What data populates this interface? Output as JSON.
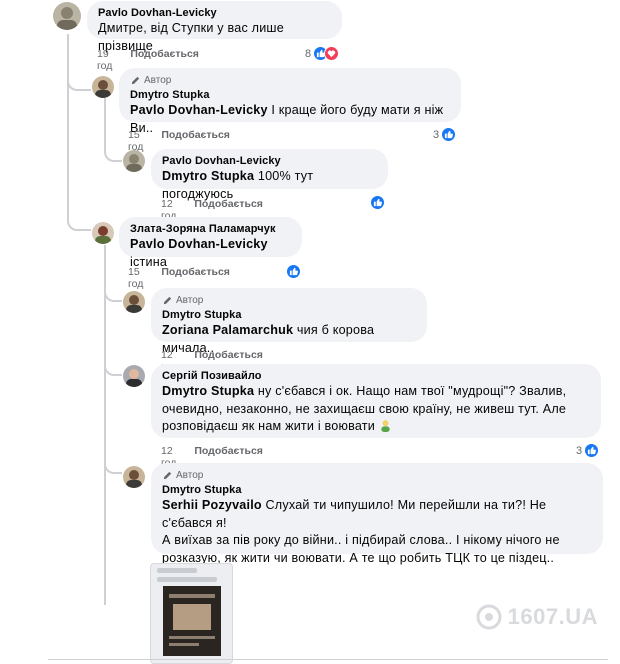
{
  "comments": [
    {
      "id": "c1",
      "author": "Pavlo Dovhan-Levicky",
      "text": "Дмитре, від Ступки у вас лише прізвище",
      "time": "19 год",
      "reply_label": "Подобається",
      "reaction_count": "8",
      "reactions": [
        "like-icon",
        "love-icon"
      ]
    },
    {
      "id": "c2",
      "badge": "Автор",
      "author": "Dmytro Stupka",
      "mention": "Pavlo Dovhan-Levicky",
      "text": "І краще його буду мати я ніж Ви..",
      "time": "15 год",
      "reply_label": "Подобається",
      "reaction_count": "3",
      "reactions": [
        "like-icon"
      ]
    },
    {
      "id": "c3",
      "author": "Pavlo Dovhan-Levicky",
      "mention": "Dmytro Stupka",
      "text": "100% тут погоджуюсь",
      "time": "12 год",
      "reply_label": "Подобається",
      "reaction_count": "",
      "reactions": [
        "like-icon"
      ]
    },
    {
      "id": "c4",
      "author": "Злата-Зоряна Паламарчук",
      "mention": "Pavlo Dovhan-Levicky",
      "text": "істина",
      "time": "15 год",
      "reply_label": "Подобається",
      "reaction_count": "",
      "reactions": [
        "like-icon"
      ]
    },
    {
      "id": "c5",
      "badge": "Автор",
      "author": "Dmytro Stupka",
      "mention": "Zoriana Palamarchuk",
      "text": "чия б корова мичала..",
      "time": "12 год",
      "reply_label": "Подобається"
    },
    {
      "id": "c6",
      "author": "Сергій Позивайло",
      "mention": "Dmytro Stupka",
      "text_lines": [
        "ну с'єбався і ок. Нащо нам твої \"мудрощі\"? Звалив,",
        "очевидно, незаконно, не захищаєш свою країну, не живеш тут. Але",
        "розповідаєш як нам жити і воювати"
      ],
      "emoji": "person-emoji",
      "time": "12 год",
      "reply_label": "Подобається",
      "reaction_count": "3",
      "reactions": [
        "like-icon"
      ]
    },
    {
      "id": "c7",
      "badge": "Автор",
      "author": "Dmytro Stupka",
      "mention": "Serhii Pozyvailo",
      "text_lines": [
        "Слухай ти чипушило! Ми перейшли на ти?! Не с'єбався я!",
        "А виїхав за пів року до війни.. і підбирай слова.. І нікому нічого не",
        "розказую, як жити чи воювати. А те що робить ТЦК то це піздец.."
      ]
    }
  ],
  "watermark": "1607.UA",
  "colors": {
    "like": "#1877f2",
    "love": "#f33e58",
    "bubble": "#f0f2f5",
    "meta": "#65676b",
    "thread_line": "#ced0d4"
  }
}
